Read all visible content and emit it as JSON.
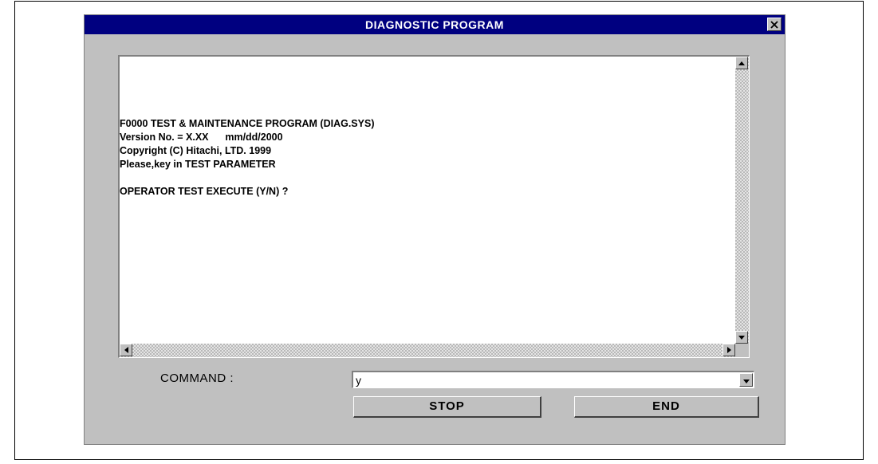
{
  "window": {
    "title": "DIAGNOSTIC PROGRAM",
    "close_glyph": "×"
  },
  "console": {
    "lines": [
      "F0000 TEST & MAINTENANCE PROGRAM (DIAG.SYS)",
      "Version No. = X.XX      mm/dd/2000",
      "Copyright (C) Hitachi, LTD. 1999",
      "Please,key in TEST PARAMETER",
      "",
      "OPERATOR TEST EXECUTE (Y/N) ?"
    ]
  },
  "command": {
    "label": "COMMAND   :",
    "value": "y"
  },
  "buttons": {
    "stop": "STOP",
    "end": "END"
  },
  "colors": {
    "title_bar": "#000080",
    "window_face": "#c0c0c0"
  }
}
